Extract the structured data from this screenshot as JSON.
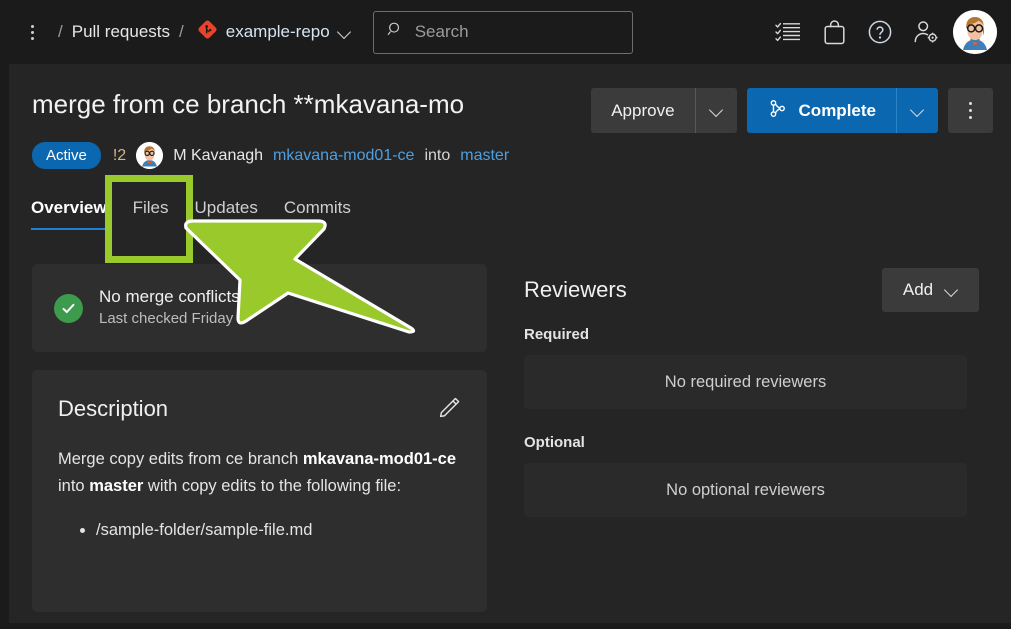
{
  "header": {
    "kebab_name": "more-options",
    "breadcrumb": {
      "separator": "/",
      "section": "Pull requests",
      "repo": "example-repo"
    },
    "search": {
      "placeholder": "Search",
      "value": ""
    },
    "icons": [
      {
        "name": "task-list-icon",
        "label": "Work items"
      },
      {
        "name": "marketplace-bag-icon",
        "label": "Marketplace"
      },
      {
        "name": "help-circle-icon",
        "label": "Help"
      },
      {
        "name": "user-settings-icon",
        "label": "User settings"
      }
    ],
    "avatar_label": "M Kavanagh"
  },
  "pull_request": {
    "title": "merge from ce branch **mkavana-mo",
    "status_badge": "Active",
    "id": "!2",
    "author": "M Kavanagh",
    "source_branch": "mkavana-mod01-ce",
    "into_word": "into",
    "target_branch": "master"
  },
  "actions": {
    "approve_label": "Approve",
    "complete_label": "Complete",
    "more_label": "More actions"
  },
  "tabs": [
    {
      "label": "Overview",
      "active": true
    },
    {
      "label": "Files",
      "active": false
    },
    {
      "label": "Updates",
      "active": false
    },
    {
      "label": "Commits",
      "active": false
    }
  ],
  "merge_status": {
    "headline": "No merge conflicts",
    "subline": "Last checked Friday",
    "icon": "check-circle-icon"
  },
  "description": {
    "title": "Description",
    "edit_icon": "pencil-edit-icon",
    "text_part_1": "Merge copy edits from ce branch ",
    "bold_1": "mkavana-mod01-ce",
    "text_part_2": " into ",
    "bold_2": "master",
    "text_part_3": " with copy edits to the following file:",
    "files": [
      "/sample-folder/sample-file.md"
    ]
  },
  "reviewers": {
    "title": "Reviewers",
    "add_label": "Add",
    "required_label": "Required",
    "required_empty": "No required reviewers",
    "optional_label": "Optional",
    "optional_empty": "No optional reviewers"
  },
  "annotation": {
    "highlight_target": "Files",
    "highlight_color": "#9ac92b",
    "arrow_color": "#9ac92b",
    "arrow_outline": "#ffffff"
  },
  "colors": {
    "page_bg": "#252525",
    "chrome_bg": "#1b1b1b",
    "card_bg": "#2e2e2e",
    "accent_blue": "#0b67b0",
    "link_blue": "#4e9fe0",
    "success_green": "#3d9b4d",
    "pr_id_gold": "#d4b483",
    "git_red": "#e8442b"
  }
}
